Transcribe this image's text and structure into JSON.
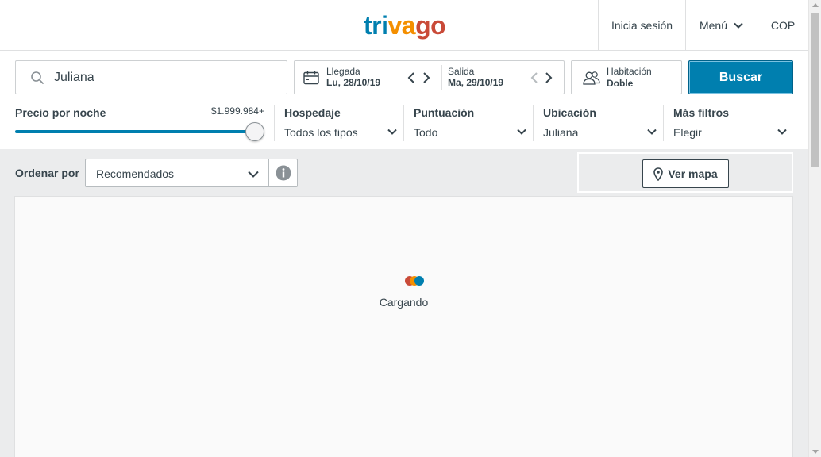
{
  "header": {
    "logo": {
      "part1": "tri",
      "part2": "va",
      "part3": "go"
    },
    "login": "Inicia sesión",
    "menu": "Menú",
    "currency": "COP"
  },
  "search": {
    "destination": "Juliana",
    "checkin_label": "Llegada",
    "checkin_value": "Lu, 28/10/19",
    "checkout_label": "Salida",
    "checkout_value": "Ma, 29/10/19",
    "room_label": "Habitación",
    "room_value": "Doble",
    "search_button": "Buscar"
  },
  "filters": {
    "price_label": "Precio por noche",
    "price_max": "$1.999.984+",
    "price_slider_position": 1.0,
    "items": [
      {
        "label": "Hospedaje",
        "value": "Todos los tipos"
      },
      {
        "label": "Puntuación",
        "value": "Todo"
      },
      {
        "label": "Ubicación",
        "value": "Juliana"
      },
      {
        "label": "Más filtros",
        "value": "Elegir"
      }
    ]
  },
  "sort": {
    "label": "Ordenar por",
    "value": "Recomendados",
    "map_button": "Ver mapa"
  },
  "results": {
    "loading_text": "Cargando"
  },
  "colors": {
    "brand_blue": "#007faf",
    "brand_orange": "#f48f00",
    "brand_red": "#c94a38"
  }
}
